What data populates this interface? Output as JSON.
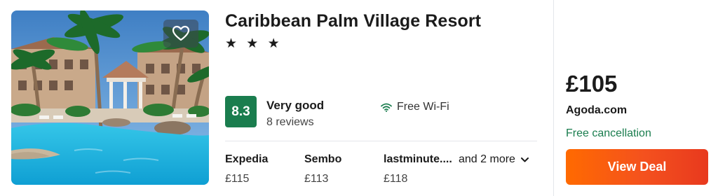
{
  "hotel": {
    "name": "Caribbean Palm Village Resort",
    "stars": "★ ★ ★",
    "rating_score": "8.3",
    "rating_label": "Very good",
    "review_count": "8 reviews",
    "amenity": "Free Wi-Fi",
    "favourite_icon": "heart-icon",
    "amenity_icon": "wifi-icon"
  },
  "providers": [
    {
      "name": "Expedia",
      "price": "£115"
    },
    {
      "name": "Sembo",
      "price": "£113"
    },
    {
      "name": "lastminute....",
      "price": "£118"
    }
  ],
  "more_label": "and 2 more",
  "deal": {
    "price": "£105",
    "site": "Agoda.com",
    "cancellation": "Free cancellation",
    "button_label": "View Deal"
  },
  "colors": {
    "rating_green": "#1a7d4e",
    "deal_orange": "#f4511e",
    "cancellation_green": "#1a7d4e"
  }
}
